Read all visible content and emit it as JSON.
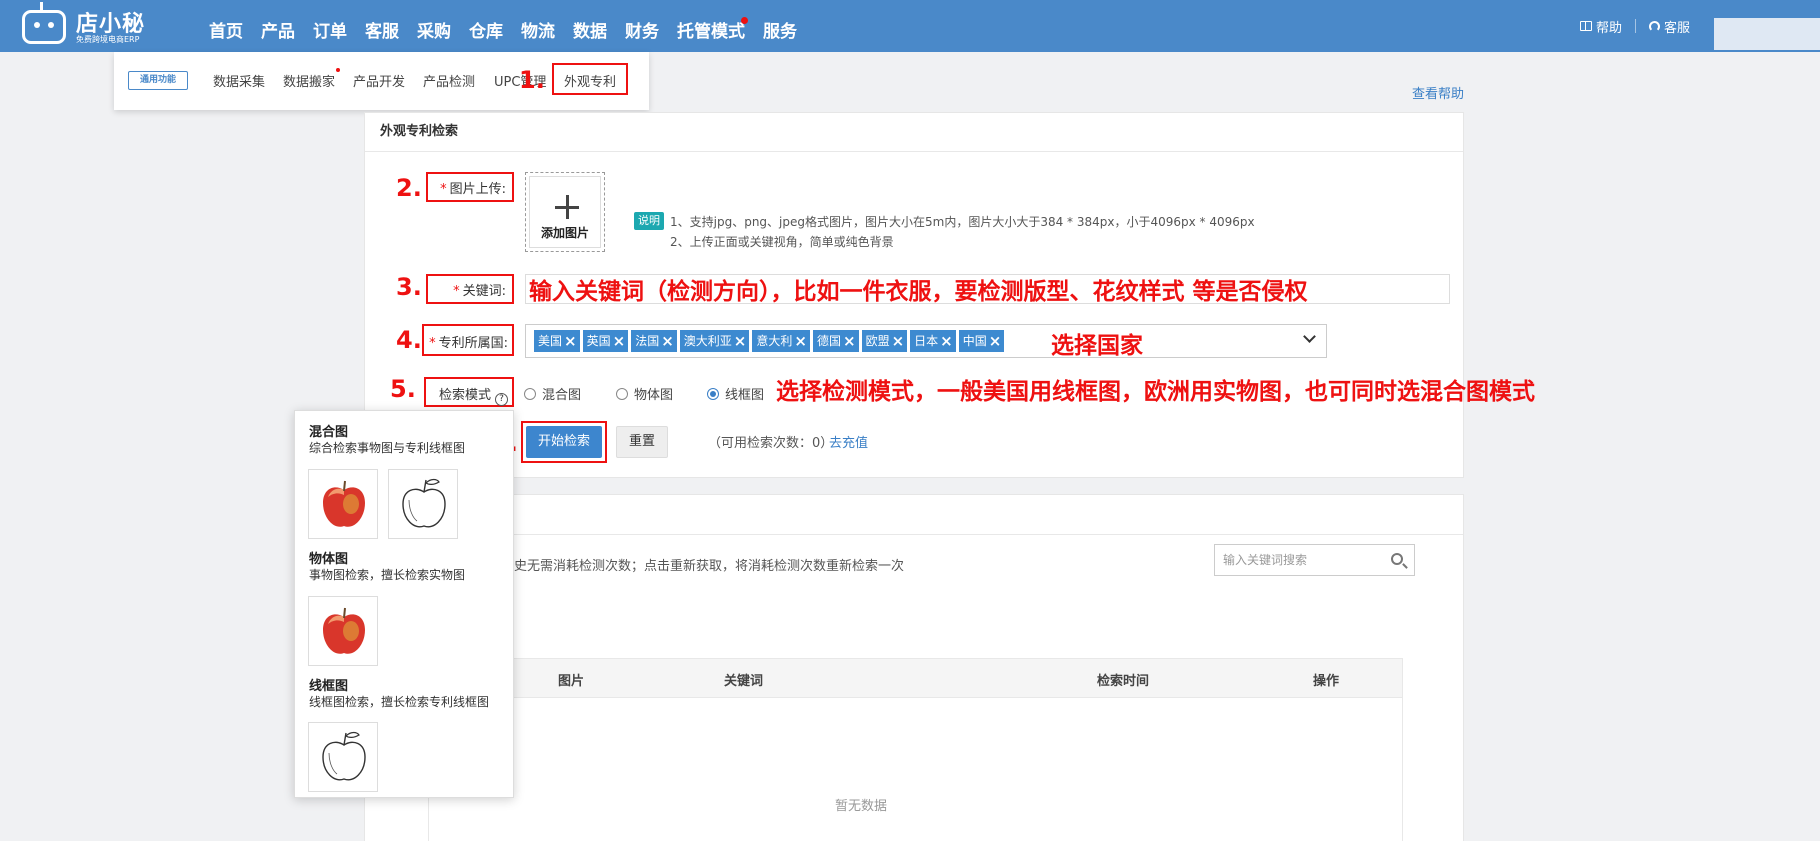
{
  "topnav": {
    "logo_text": "店小秘",
    "logo_sub": "免费跨境电商ERP",
    "items": [
      "首页",
      "产品",
      "订单",
      "客服",
      "采购",
      "仓库",
      "物流",
      "数据",
      "财务",
      "托管模式",
      "服务"
    ],
    "help": "帮助",
    "service": "客服"
  },
  "submenu": {
    "tag": "通用功能",
    "items": [
      "数据采集",
      "数据搬家",
      "产品开发",
      "产品检测",
      "UPC管理",
      "外观专利"
    ]
  },
  "help_link": "查看帮助",
  "search_card": {
    "title": "外观专利检索",
    "upload_label": "图片上传:",
    "upload_button": "添加图片",
    "note_tag": "说明",
    "notes": [
      "1、支持jpg、png、jpeg格式图片，图片大小在5m内，图片大小大于384 * 384px，小于4096px * 4096px",
      "2、上传正面或关键视角，简单或纯色背景"
    ],
    "keyword_label": "关键词:",
    "country_label": "专利所属国:",
    "countries": [
      "美国",
      "英国",
      "法国",
      "澳大利亚",
      "意大利",
      "德国",
      "欧盟",
      "日本",
      "中国"
    ],
    "mode_label": "检索模式",
    "modes": [
      {
        "label": "混合图",
        "checked": false
      },
      {
        "label": "物体图",
        "checked": false
      },
      {
        "label": "线框图",
        "checked": true
      }
    ],
    "start_button": "开始检索",
    "reset_button": "重置",
    "count_text": "（可用检索次数：0）",
    "recharge": "去充值"
  },
  "annotations": {
    "steps": [
      "1.",
      "2.",
      "3.",
      "4.",
      "5.",
      "6."
    ],
    "keyword_hint": "输入关键词（检测方向），比如一件衣服，要检测版型、花纹样式 等是否侵权",
    "country_hint": "选择国家",
    "mode_hint": "选择检测模式，一般美国用线框图，欧洲用实物图，也可同时选混合图模式"
  },
  "history": {
    "note": "史无需消耗检测次数；点击重新获取，将消耗检测次数重新检索一次",
    "search_placeholder": "输入关键词搜索",
    "columns": [
      "图片",
      "关键词",
      "检索时间",
      "操作"
    ],
    "empty": "暂无数据"
  },
  "popup": {
    "sections": [
      {
        "title": "混合图",
        "desc": "综合检索事物图与专利线框图"
      },
      {
        "title": "物体图",
        "desc": "事物图检索，擅长检索实物图"
      },
      {
        "title": "线框图",
        "desc": "线框图检索，擅长检索专利线框图"
      }
    ]
  },
  "colors": {
    "nav": "#4a89c9",
    "annotation": "#e11111",
    "primary": "#3d86ce",
    "tag": "#3d8ad0"
  }
}
